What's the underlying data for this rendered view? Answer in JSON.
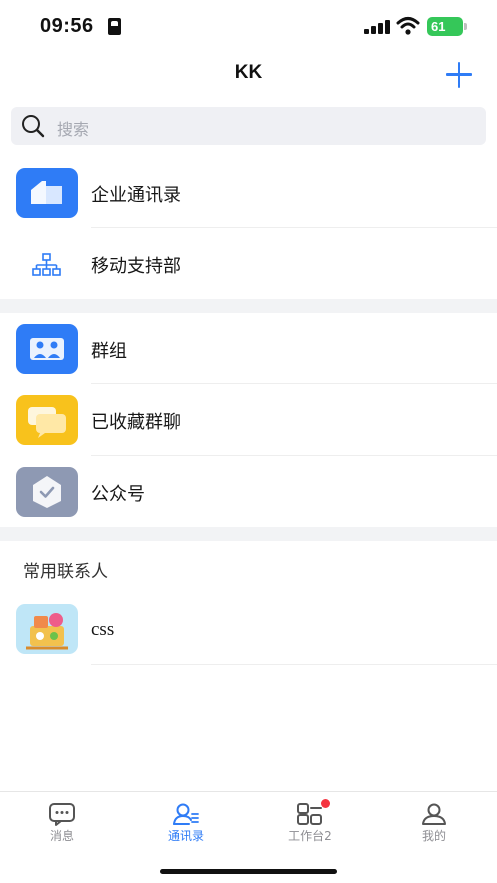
{
  "status_bar": {
    "time": "09:56",
    "battery": "61"
  },
  "nav": {
    "title": "KK"
  },
  "search": {
    "placeholder": "搜索"
  },
  "rows": [
    {
      "label": "企业通讯录",
      "icon": "building-icon"
    },
    {
      "label": "移动支持部",
      "icon": "org-chart-icon"
    },
    {
      "label": "群组",
      "icon": "group-icon"
    },
    {
      "label": "已收藏群聊",
      "icon": "chat-bubbles-icon"
    },
    {
      "label": "公众号",
      "icon": "verified-badge-icon"
    }
  ],
  "frequent": {
    "title": "常用联系人",
    "contacts": [
      {
        "name": "css"
      }
    ]
  },
  "tabs": [
    {
      "label": "消息",
      "icon": "message-icon",
      "active": false
    },
    {
      "label": "通讯录",
      "icon": "contacts-icon",
      "active": true
    },
    {
      "label": "工作台2",
      "icon": "workbench-icon",
      "active": false,
      "badge_dot": true
    },
    {
      "label": "我的",
      "icon": "profile-icon",
      "active": false
    }
  ],
  "colors": {
    "accent": "#2f7cf6",
    "blue_icon": "#2f7cf6",
    "yellow_icon": "#f8c21c",
    "gray_icon": "#8e99b3",
    "badge_red": "#f5333f",
    "battery_green": "#35c759"
  }
}
